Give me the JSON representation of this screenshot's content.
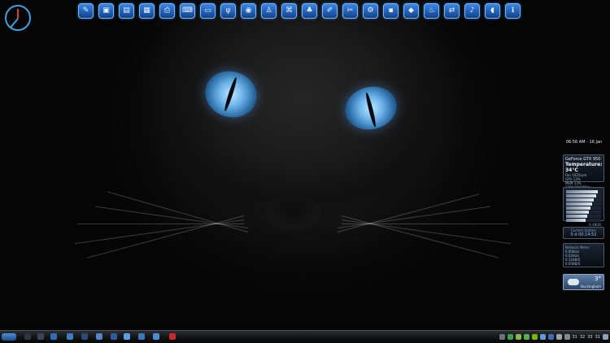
{
  "top_dock": {
    "items": [
      {
        "icon": "pin-icon",
        "glyph": "✎"
      },
      {
        "icon": "monitor-icon",
        "glyph": "▣"
      },
      {
        "icon": "window-icon",
        "glyph": "▤"
      },
      {
        "icon": "screen-icon",
        "glyph": "▦"
      },
      {
        "icon": "printer-icon",
        "glyph": "⎙"
      },
      {
        "icon": "keyboard-icon",
        "glyph": "⌨"
      },
      {
        "icon": "drive-icon",
        "glyph": "▭"
      },
      {
        "icon": "usb-icon",
        "glyph": "ψ"
      },
      {
        "icon": "globe-icon",
        "glyph": "◉"
      },
      {
        "icon": "person-icon",
        "glyph": "♙"
      },
      {
        "icon": "network-icon",
        "glyph": "⌘"
      },
      {
        "icon": "tree-icon",
        "glyph": "♣"
      },
      {
        "icon": "paint-icon",
        "glyph": "✐"
      },
      {
        "icon": "tools-icon",
        "glyph": "✂"
      },
      {
        "icon": "gear-icon",
        "glyph": "⚙"
      },
      {
        "icon": "save-icon",
        "glyph": "▪"
      },
      {
        "icon": "shield-icon",
        "glyph": "◆"
      },
      {
        "icon": "flame-icon",
        "glyph": "♨"
      },
      {
        "icon": "network-share-icon",
        "glyph": "⇄"
      },
      {
        "icon": "microphone-icon",
        "glyph": "♪"
      },
      {
        "icon": "mouse-icon",
        "glyph": "◖"
      },
      {
        "icon": "info-icon",
        "glyph": "ℹ"
      }
    ]
  },
  "clock": {
    "time_date": "06:56 AM - 16 Jan"
  },
  "gpu_gadget": {
    "title": "GeForce GTX 950",
    "temperature": "Temperature: 34°C",
    "lines": [
      "Fan 1025rpm",
      "GPU 13%",
      "MEM 13%",
      "1266/3004MHz"
    ]
  },
  "cpu_gadget": {
    "bars": [
      0.9,
      0.85,
      0.8,
      0.75,
      0.7,
      0.65,
      0.6,
      0.55
    ],
    "footer": "0.48GB"
  },
  "uptime": {
    "label": "Current Uptime",
    "value": "0 d 00:14:52"
  },
  "network_gadget": {
    "label": "Network Meter",
    "rows": [
      "0.00kb/s",
      "0.02kb/s",
      "0.11KB/S",
      "0.05KB/S"
    ]
  },
  "weather": {
    "temperature": "3°",
    "city": "Buckingham"
  },
  "taskbar": {
    "tray_numbers": [
      "31",
      "32",
      "33",
      "31"
    ]
  }
}
